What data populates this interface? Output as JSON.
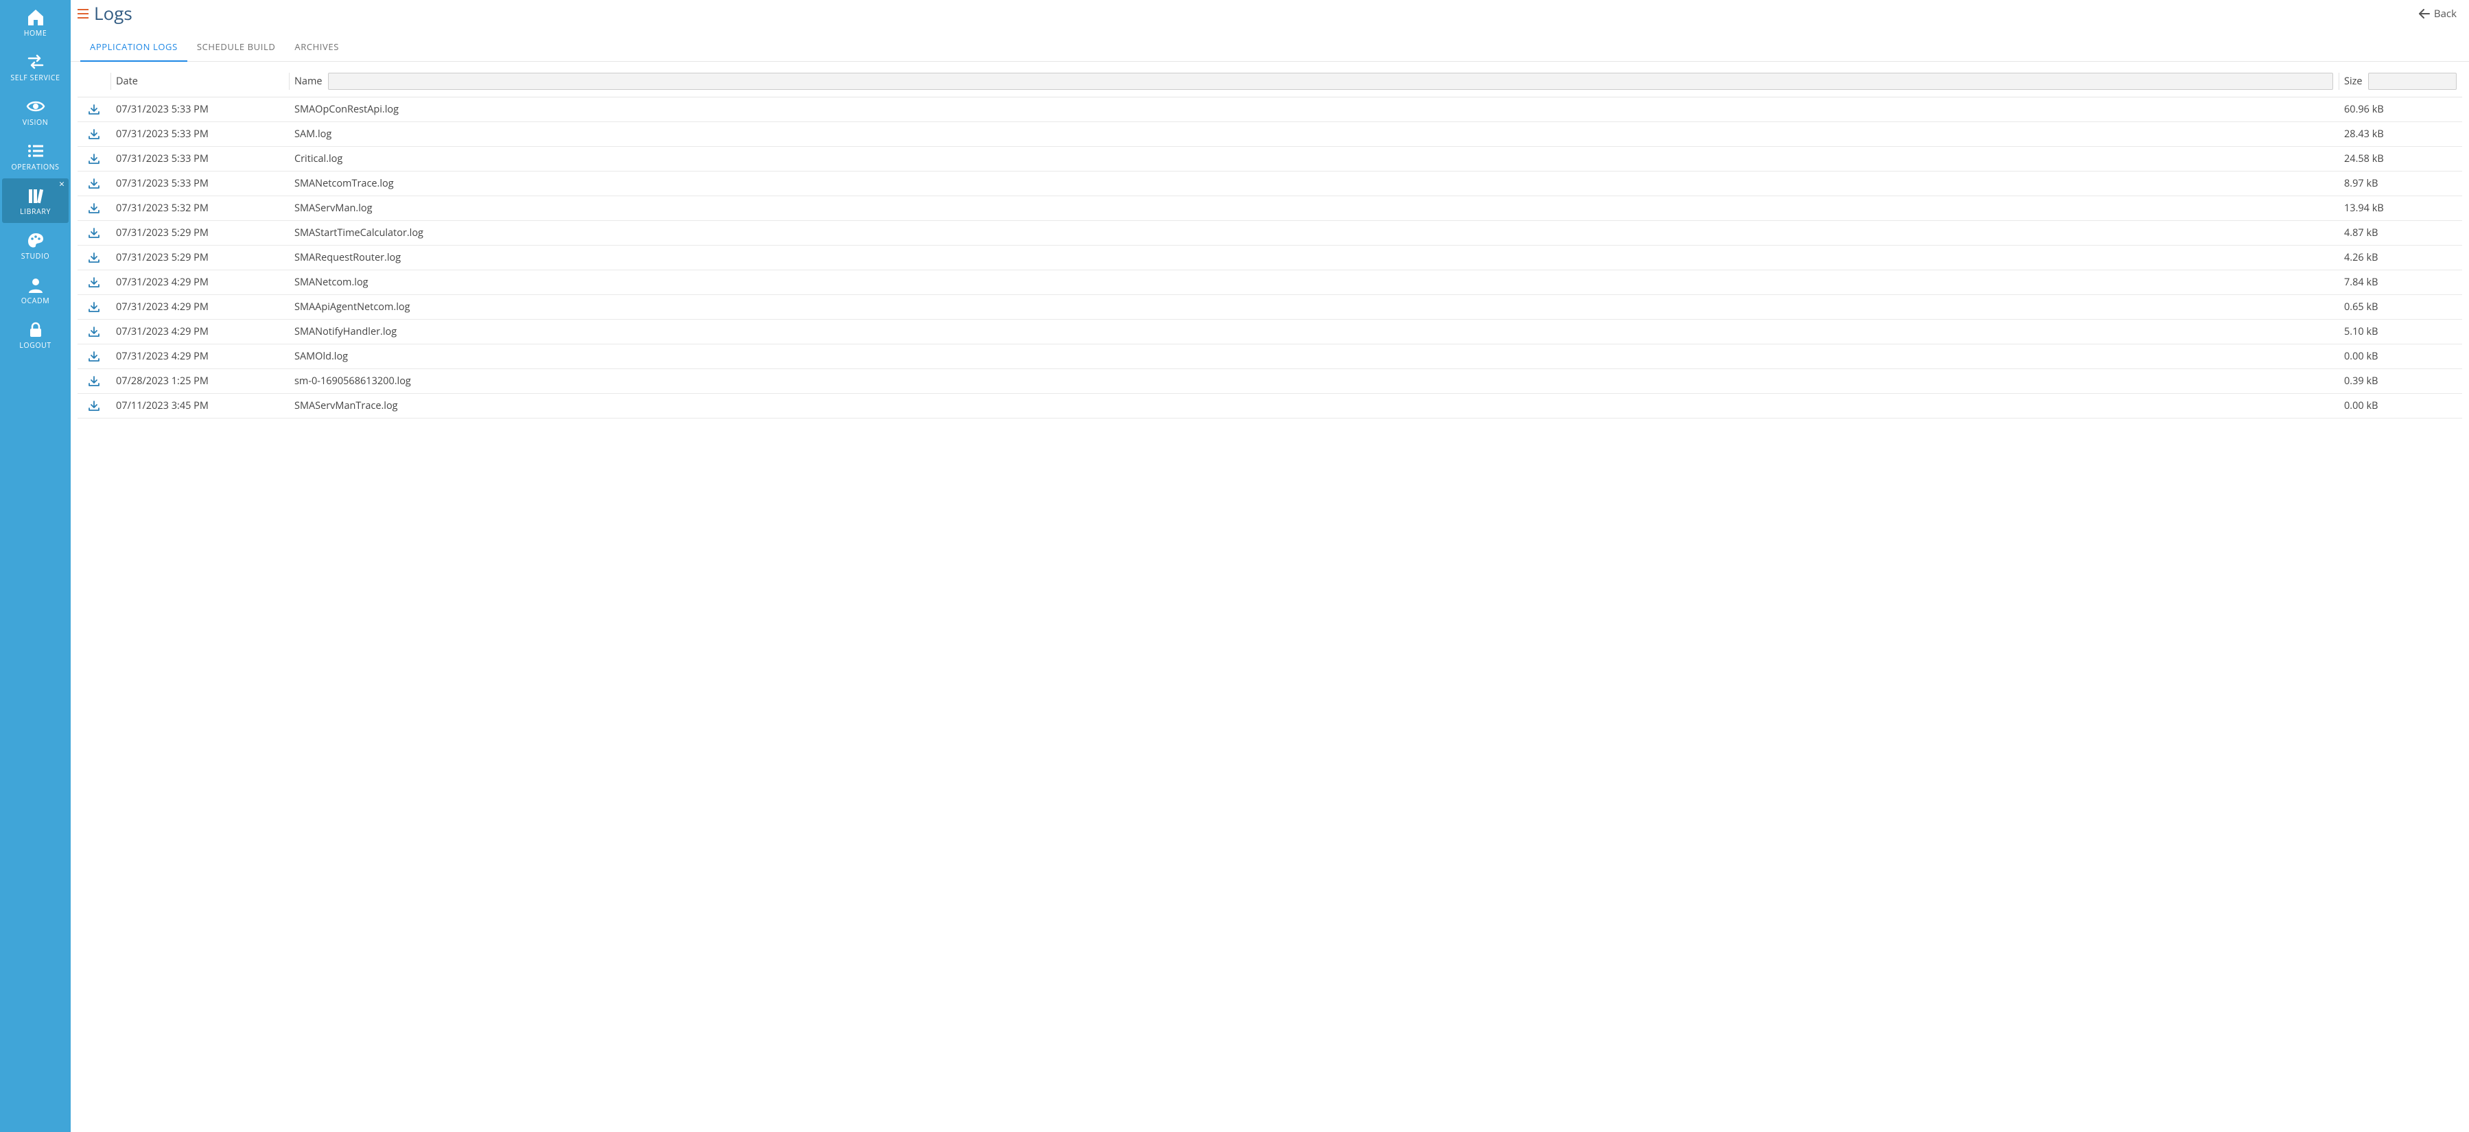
{
  "sidebar": {
    "items": [
      {
        "label": "HOME",
        "icon": "home"
      },
      {
        "label": "SELF SERVICE",
        "icon": "swap"
      },
      {
        "label": "VISION",
        "icon": "eye"
      },
      {
        "label": "OPERATIONS",
        "icon": "list"
      },
      {
        "label": "LIBRARY",
        "icon": "books",
        "active": true
      },
      {
        "label": "STUDIO",
        "icon": "palette"
      },
      {
        "label": "OCADM",
        "icon": "user"
      },
      {
        "label": "LOGOUT",
        "icon": "lock"
      }
    ]
  },
  "header": {
    "title": "Logs",
    "back_label": "Back"
  },
  "tabs": [
    {
      "label": "APPLICATION LOGS",
      "active": true
    },
    {
      "label": "SCHEDULE BUILD",
      "active": false
    },
    {
      "label": "ARCHIVES",
      "active": false
    }
  ],
  "table": {
    "columns": {
      "date": "Date",
      "name": "Name",
      "size": "Size"
    },
    "filters": {
      "name": "",
      "size": ""
    },
    "rows": [
      {
        "date": "07/31/2023 5:33 PM",
        "name": "SMAOpConRestApi.log",
        "size": "60.96 kB"
      },
      {
        "date": "07/31/2023 5:33 PM",
        "name": "SAM.log",
        "size": "28.43 kB"
      },
      {
        "date": "07/31/2023 5:33 PM",
        "name": "Critical.log",
        "size": "24.58 kB"
      },
      {
        "date": "07/31/2023 5:33 PM",
        "name": "SMANetcomTrace.log",
        "size": "8.97 kB"
      },
      {
        "date": "07/31/2023 5:32 PM",
        "name": "SMAServMan.log",
        "size": "13.94 kB"
      },
      {
        "date": "07/31/2023 5:29 PM",
        "name": "SMAStartTimeCalculator.log",
        "size": "4.87 kB"
      },
      {
        "date": "07/31/2023 5:29 PM",
        "name": "SMARequestRouter.log",
        "size": "4.26 kB"
      },
      {
        "date": "07/31/2023 4:29 PM",
        "name": "SMANetcom.log",
        "size": "7.84 kB"
      },
      {
        "date": "07/31/2023 4:29 PM",
        "name": "SMAApiAgentNetcom.log",
        "size": "0.65 kB"
      },
      {
        "date": "07/31/2023 4:29 PM",
        "name": "SMANotifyHandler.log",
        "size": "5.10 kB"
      },
      {
        "date": "07/31/2023 4:29 PM",
        "name": "SAMOld.log",
        "size": "0.00 kB"
      },
      {
        "date": "07/28/2023 1:25 PM",
        "name": "sm-0-1690568613200.log",
        "size": "0.39 kB"
      },
      {
        "date": "07/11/2023 3:45 PM",
        "name": "SMAServManTrace.log",
        "size": "0.00 kB"
      }
    ]
  }
}
